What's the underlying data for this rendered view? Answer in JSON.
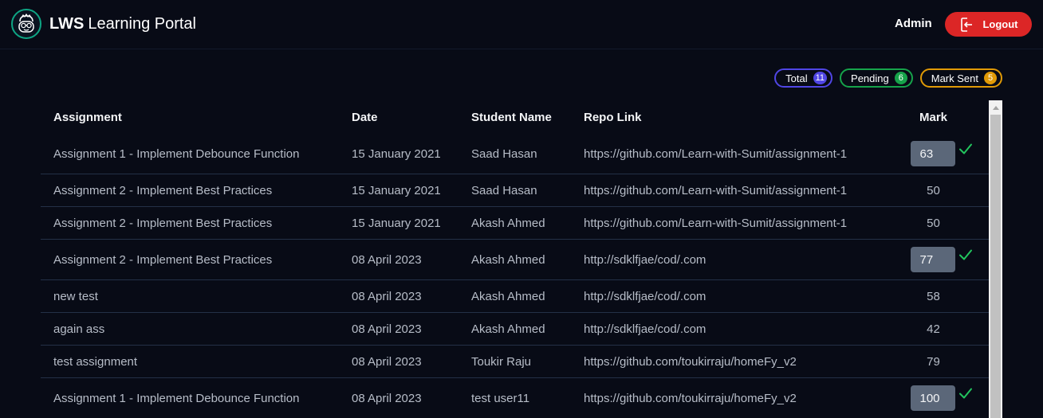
{
  "header": {
    "brand_strong": "LWS",
    "brand_rest": "Learning Portal",
    "user": "Admin",
    "logout_label": "Logout"
  },
  "status": {
    "total_label": "Total",
    "total_count": "11",
    "pending_label": "Pending",
    "pending_count": "6",
    "sent_label": "Mark Sent",
    "sent_count": "5"
  },
  "table": {
    "columns": [
      "Assignment",
      "Date",
      "Student Name",
      "Repo Link",
      "Mark"
    ],
    "rows": [
      {
        "assignment": "Assignment 1 - Implement Debounce Function",
        "date": "15 January 2021",
        "student": "Saad Hasan",
        "repo": "https://github.com/Learn-with-Sumit/assignment-1",
        "mark": "63",
        "pending": true
      },
      {
        "assignment": "Assignment 2 - Implement Best Practices",
        "date": "15 January 2021",
        "student": "Saad Hasan",
        "repo": "https://github.com/Learn-with-Sumit/assignment-1",
        "mark": "50",
        "pending": false
      },
      {
        "assignment": "Assignment 2 - Implement Best Practices",
        "date": "15 January 2021",
        "student": "Akash Ahmed",
        "repo": "https://github.com/Learn-with-Sumit/assignment-1",
        "mark": "50",
        "pending": false
      },
      {
        "assignment": "Assignment 2 - Implement Best Practices",
        "date": "08 April 2023",
        "student": "Akash Ahmed",
        "repo": "http://sdklfjae/cod/.com",
        "mark": "77",
        "pending": true
      },
      {
        "assignment": "new test",
        "date": "08 April 2023",
        "student": "Akash Ahmed",
        "repo": "http://sdklfjae/cod/.com",
        "mark": "58",
        "pending": false
      },
      {
        "assignment": "again ass",
        "date": "08 April 2023",
        "student": "Akash Ahmed",
        "repo": "http://sdklfjae/cod/.com",
        "mark": "42",
        "pending": false
      },
      {
        "assignment": "test assignment",
        "date": "08 April 2023",
        "student": "Toukir Raju",
        "repo": "https://github.com/toukirraju/homeFy_v2",
        "mark": "79",
        "pending": false
      },
      {
        "assignment": "Assignment 1 - Implement Debounce Function",
        "date": "08 April 2023",
        "student": "test user11",
        "repo": "https://github.com/toukirraju/homeFy_v2",
        "mark": "100",
        "pending": true
      }
    ]
  },
  "colors": {
    "background": "#080b16",
    "logout": "#dc2626",
    "total": "#5046e5",
    "pending": "#16a34a",
    "sent": "#e19a06",
    "check": "#22c55e"
  },
  "icons": {
    "logo": "geek-face-logo-icon",
    "logout": "logout-icon",
    "submit": "check-icon"
  }
}
